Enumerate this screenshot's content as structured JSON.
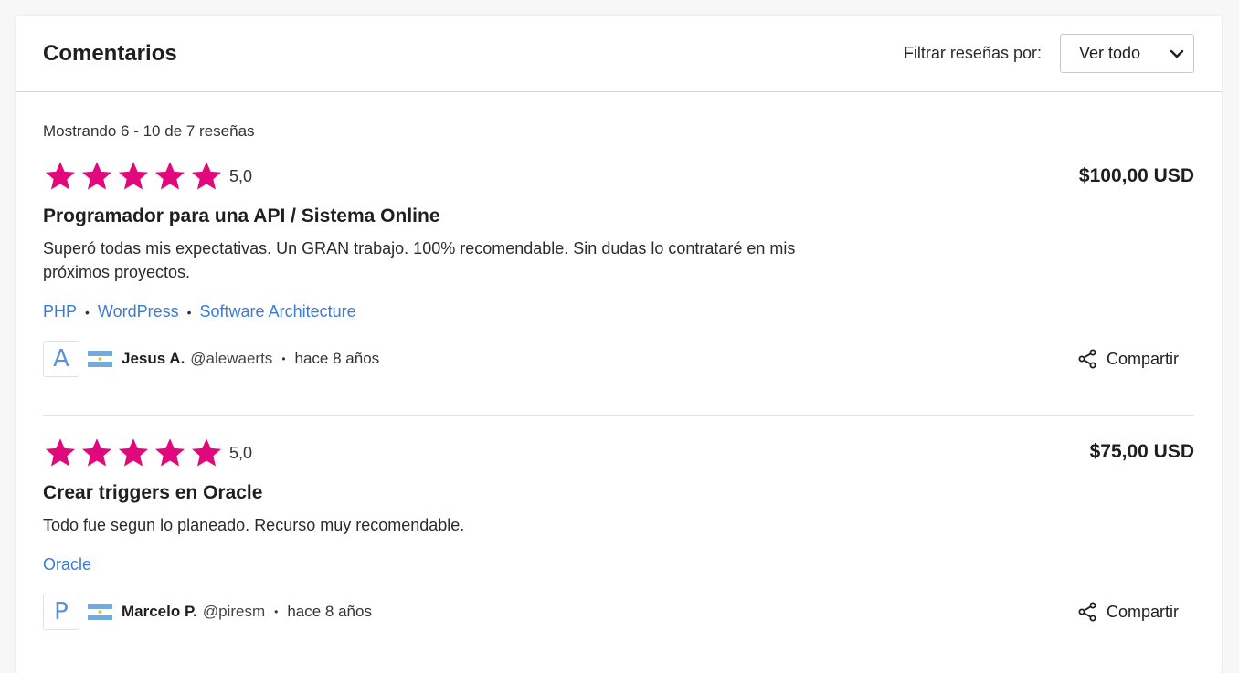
{
  "header": {
    "title": "Comentarios",
    "filter_label": "Filtrar reseñas por:",
    "filter_value": "Ver todo"
  },
  "summary": "Mostrando 6 - 10 de 7 reseñas",
  "colors": {
    "star": "#e0087c",
    "link": "#3a7bd5",
    "flag_blue": "#75aadb"
  },
  "reviews": [
    {
      "rating": "5,0",
      "stars": 5,
      "price": "$100,00 USD",
      "title": "Programador para una API / Sistema Online",
      "text": "Superó todas mis expectativas. Un GRAN trabajo. 100% recomendable. Sin dudas lo contrataré en mis próximos proyectos.",
      "skills": [
        "PHP",
        "WordPress",
        "Software Architecture"
      ],
      "avatar_letter": "A",
      "flag": "argentina-flag",
      "user_name": "Jesus A.",
      "user_handle": "@alewaerts",
      "time": "hace 8 años",
      "share_label": "Compartir"
    },
    {
      "rating": "5,0",
      "stars": 5,
      "price": "$75,00 USD",
      "title": "Crear triggers en Oracle",
      "text": "Todo fue segun lo planeado. Recurso muy recomendable.",
      "skills": [
        "Oracle"
      ],
      "avatar_letter": "P",
      "flag": "argentina-flag",
      "user_name": "Marcelo P.",
      "user_handle": "@piresm",
      "time": "hace 8 años",
      "share_label": "Compartir"
    }
  ]
}
